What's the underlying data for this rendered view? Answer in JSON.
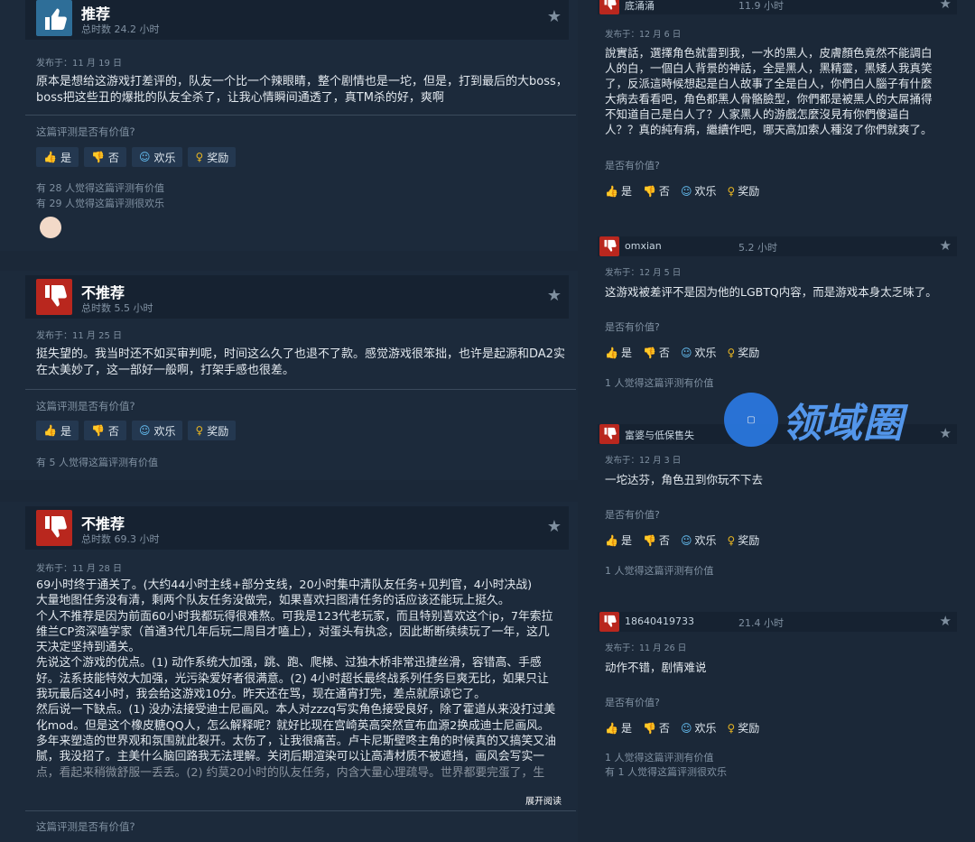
{
  "left_reviews": [
    {
      "verdict": "推荐",
      "hours": "总时数 24.2 小时",
      "posted": "发布于：11 月 19 日",
      "text_lines": [
        "原本是想给这游戏打差评的，队友一个比一个辣眼睛，整个剧情也是一坨，但是，打到最后的大boss，",
        "boss把这些丑的爆批的队友全杀了，让我心情瞬间通透了，真TM杀的好，爽啊"
      ],
      "helpful_q": "这篇评测是否有价值?",
      "count_lines": [
        "有 28 人觉得这篇评测有价值",
        "有 29 人觉得这篇评测很欢乐"
      ]
    },
    {
      "verdict": "不推荐",
      "hours": "总时数 5.5 小时",
      "posted": "发布于：11 月 25 日",
      "text_lines": [
        "挺失望的。我当时还不如买审判呢，时间这么久了也退不了款。感觉游戏很笨拙，也许是起源和DA2实",
        "在太美妙了，这一部好一般啊，打架手感也很差。"
      ],
      "helpful_q": "这篇评测是否有价值?",
      "count_lines": [
        "有 5 人觉得这篇评测有价值"
      ]
    },
    {
      "verdict": "不推荐",
      "hours": "总时数 69.3 小时",
      "posted": "发布于：11 月 28 日",
      "text_lines": [
        "69小时终于通关了。(大约44小时主线+部分支线，20小时集中清队友任务+见判官，4小时决战)",
        "大量地图任务没有清，剩两个队友任务没做完，如果喜欢扫图清任务的话应该还能玩上挺久。",
        "个人不推荐是因为前面60小时我都玩得很难熬。可我是123代老玩家，而且特别喜欢这个ip，7年索拉",
        "维兰CP资深嗑学家（首通3代几年后玩二周目才嗑上），对蛋头有执念，因此断断续续玩了一年，这几",
        "天决定坚持到通关。",
        "先说这个游戏的优点。(1) 动作系统大加强，跳、跑、爬梯、过独木桥非常迅捷丝滑，容错高、手感",
        "好。法系技能特效大加强，光污染爱好者很满意。(2) 4小时超长最终战系列任务巨爽无比，如果只让",
        "我玩最后这4小时，我会给这游戏10分。昨天还在骂，现在通宵打完，差点就原谅它了。",
        "然后说一下缺点。(1) 没办法接受迪士尼画风。本人对zzzq写实角色接受良好，除了霍道从来没打过美",
        "化mod。但是这个橡皮糖QQ人，怎么解释呢？就好比现在宫崎英高突然宣布血源2换成迪士尼画风。",
        "多年来塑造的世界观和氛围就此裂开。太伤了，让我很痛苦。卢卡尼斯壁咚主角的时候真的又搞笑又油",
        "腻，我没招了。主美什么脑回路我无法理解。关闭后期渲染可以让高清材质不被遮挡，画风会写实一",
        "点，看起来稍微舒服一丢丢。(2) 约莫20小时的队友任务，内含大量心理疏导。世界都要完蛋了，生"
      ],
      "read_more": "展开阅读",
      "helpful_q": "这篇评测是否有价值?"
    }
  ],
  "buttons": {
    "yes": "是",
    "no": "否",
    "funny": "欢乐",
    "award": "奖励"
  },
  "right_reviews": [
    {
      "name": "底涌涌",
      "hours": "11.9 小时",
      "posted": "发布于：12 月 6 日",
      "text_lines": [
        "說實話，選擇角色就雷到我，一水的黑人，皮膚顏色竟然不能調白",
        "人的白，一個白人背景的神話，全是黑人，黑精靈，黑矮人我真笑",
        "了，反派這時候想起是白人故事了全是白人，你們白人腦子有什麼",
        "大病去看看吧，角色都黑人骨骼臉型，你們都是被黑人的大屌捅得",
        "不知道自己是白人了？人家黑人的游戲怎麼沒見有你們傻逼白",
        "人？？真的純有病，繼續作吧，哪天高加索人種沒了你們就爽了。"
      ],
      "helpful_q": "是否有价值?"
    },
    {
      "name": "omxian",
      "hours": "5.2 小时",
      "posted": "发布于：12 月 5 日",
      "text_lines": [
        "这游戏被差评不是因为他的LGBTQ内容，而是游戏本身太乏味了。"
      ],
      "helpful_q": "是否有价值?",
      "count_lines": [
        "1 人觉得这篇评测有价值"
      ]
    },
    {
      "name": "富婆与低保售失",
      "hours": "",
      "posted": "发布于：12 月 3 日",
      "text_lines": [
        "一坨达芬，角色丑到你玩不下去"
      ],
      "helpful_q": "是否有价值?",
      "count_lines": [
        "1 人觉得这篇评测有价值"
      ]
    },
    {
      "name": "18640419733",
      "hours": "21.4 小时",
      "posted": "发布于：11 月 26 日",
      "text_lines": [
        "动作不错，剧情难说"
      ],
      "helpful_q": "是否有价值?",
      "count_lines": [
        "1 人觉得这篇评测有价值",
        "有 1 人觉得这篇评测很欢乐"
      ]
    }
  ],
  "watermark": {
    "text": "领域圈"
  }
}
